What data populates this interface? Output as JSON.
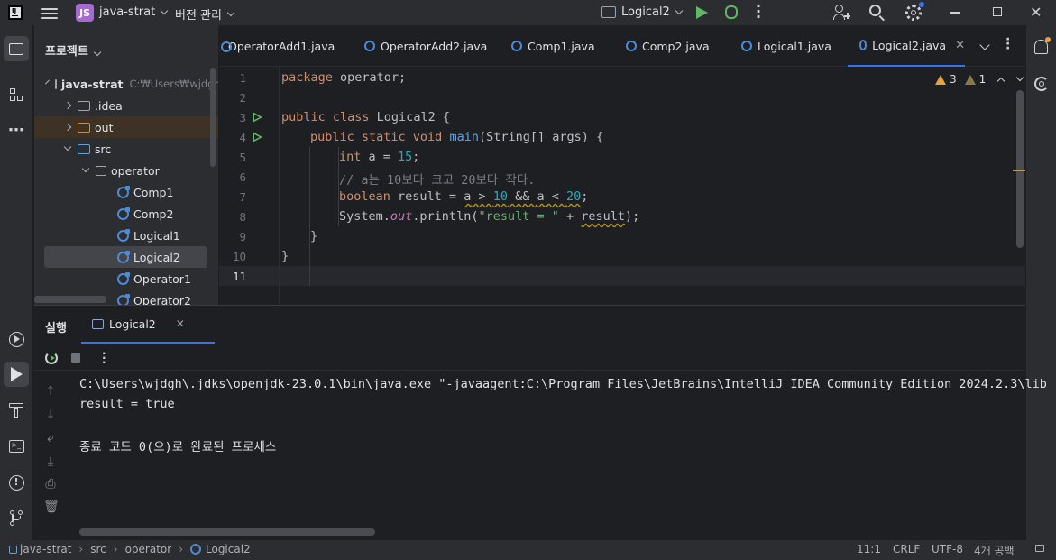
{
  "titlebar": {
    "project_badge": "JS",
    "project_name": "java-strat",
    "vcs_label": "버전 관리",
    "run_config": "Logical2"
  },
  "project_panel": {
    "title": "프로젝트",
    "tree": [
      {
        "label": "java-strat",
        "hint": "C:₩Users₩wjdgh"
      },
      {
        "label": ".idea"
      },
      {
        "label": "out"
      },
      {
        "label": "src"
      },
      {
        "label": "operator"
      },
      {
        "label": "Comp1"
      },
      {
        "label": "Comp2"
      },
      {
        "label": "Logical1"
      },
      {
        "label": "Logical2"
      },
      {
        "label": "Operator1"
      },
      {
        "label": "Operator2"
      }
    ]
  },
  "tabs": [
    {
      "label": "OperatorAdd1.java"
    },
    {
      "label": "OperatorAdd2.java"
    },
    {
      "label": "Comp1.java"
    },
    {
      "label": "Comp2.java"
    },
    {
      "label": "Logical1.java"
    },
    {
      "label": "Logical2.java",
      "active": true
    }
  ],
  "inspections": {
    "warnings": "3",
    "weak_warnings": "1"
  },
  "editor": {
    "line_numbers": [
      "1",
      "2",
      "3",
      "4",
      "5",
      "6",
      "7",
      "8",
      "9",
      "10",
      "11"
    ],
    "code": {
      "l1_kw": "package",
      "l1_rest": " operator;",
      "l3_kw": "public class",
      "l3_rest": " Logical2 {",
      "l4_kw": "public static void",
      "l4_fn": "main",
      "l4_rest": "(String[] args) {",
      "l5_kw": "int",
      "l5_rest": " a = ",
      "l5_num": "15",
      "l5_end": ";",
      "l6_cmt": "// a는 10보다 크고 20보다 작다.",
      "l7_kw": "boolean",
      "l7_var": " result = ",
      "l7_a1": "a",
      "l7_gt": " > ",
      "l7_n1": "10",
      "l7_and": " && ",
      "l7_a2": "a",
      "l7_lt": " < ",
      "l7_n2": "20",
      "l7_end": ";",
      "l8_sys": "System.",
      "l8_out": "out",
      "l8_println": ".println(",
      "l8_str": "\"result = \"",
      "l8_plus": " + ",
      "l8_result": "result",
      "l8_end": ");",
      "l9": "}",
      "l10": "}"
    }
  },
  "run_panel": {
    "title": "실행",
    "tab_label": "Logical2",
    "console": [
      "C:\\Users\\wjdgh\\.jdks\\openjdk-23.0.1\\bin\\java.exe \"-javaagent:C:\\Program Files\\JetBrains\\IntelliJ IDEA Community Edition 2024.2.3\\lib",
      "result = true",
      "",
      "종료 코드 0(으)로 완료된 프로세스"
    ]
  },
  "statusbar": {
    "crumbs": [
      "java-strat",
      "src",
      "operator",
      "Logical2"
    ],
    "position": "11:1",
    "line_sep": "CRLF",
    "encoding": "UTF-8",
    "indent": "4개 공백"
  },
  "colors": {
    "accent": "#3574f0",
    "run_green": "#5fb864",
    "badge_purple": "#a66bd3"
  }
}
